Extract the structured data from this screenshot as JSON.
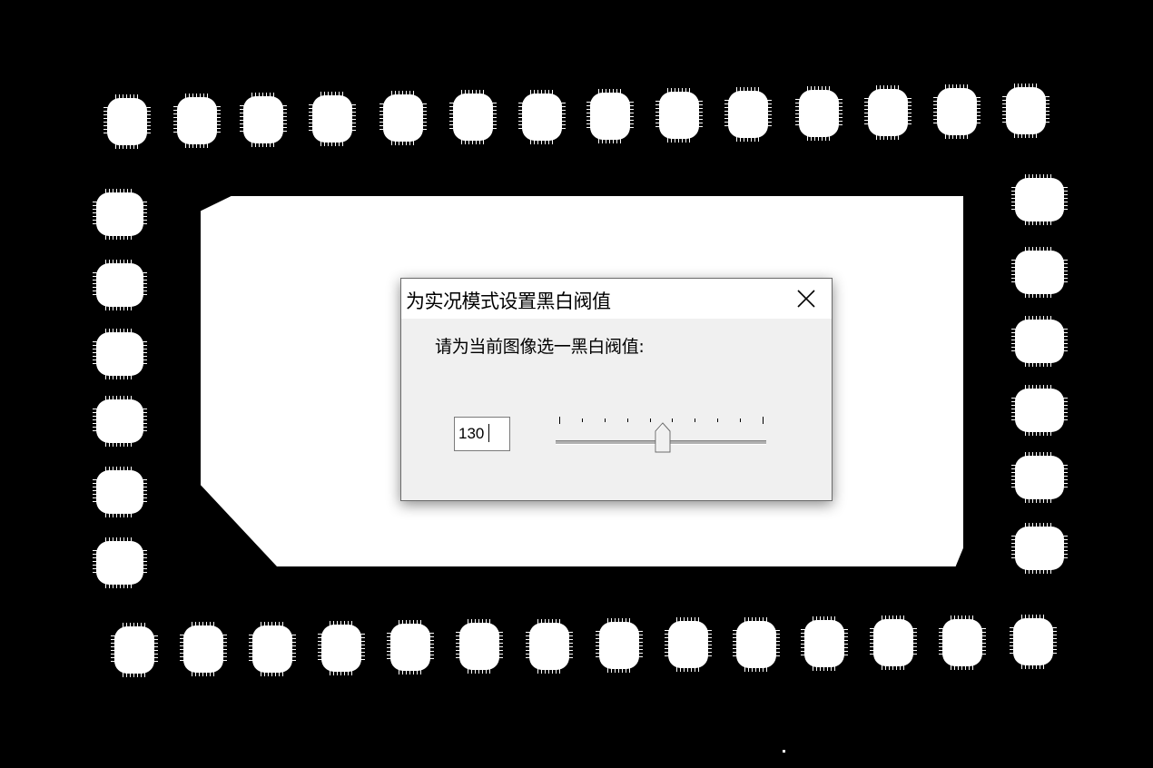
{
  "dialog": {
    "title": "为实况模式设置黑白阀值",
    "prompt": "请为当前图像选一黑白阀值:",
    "threshold_value": "130",
    "slider": {
      "min": 0,
      "max": 255,
      "value": 130,
      "ticks": 9
    }
  },
  "icons": {
    "close": "close-icon"
  }
}
